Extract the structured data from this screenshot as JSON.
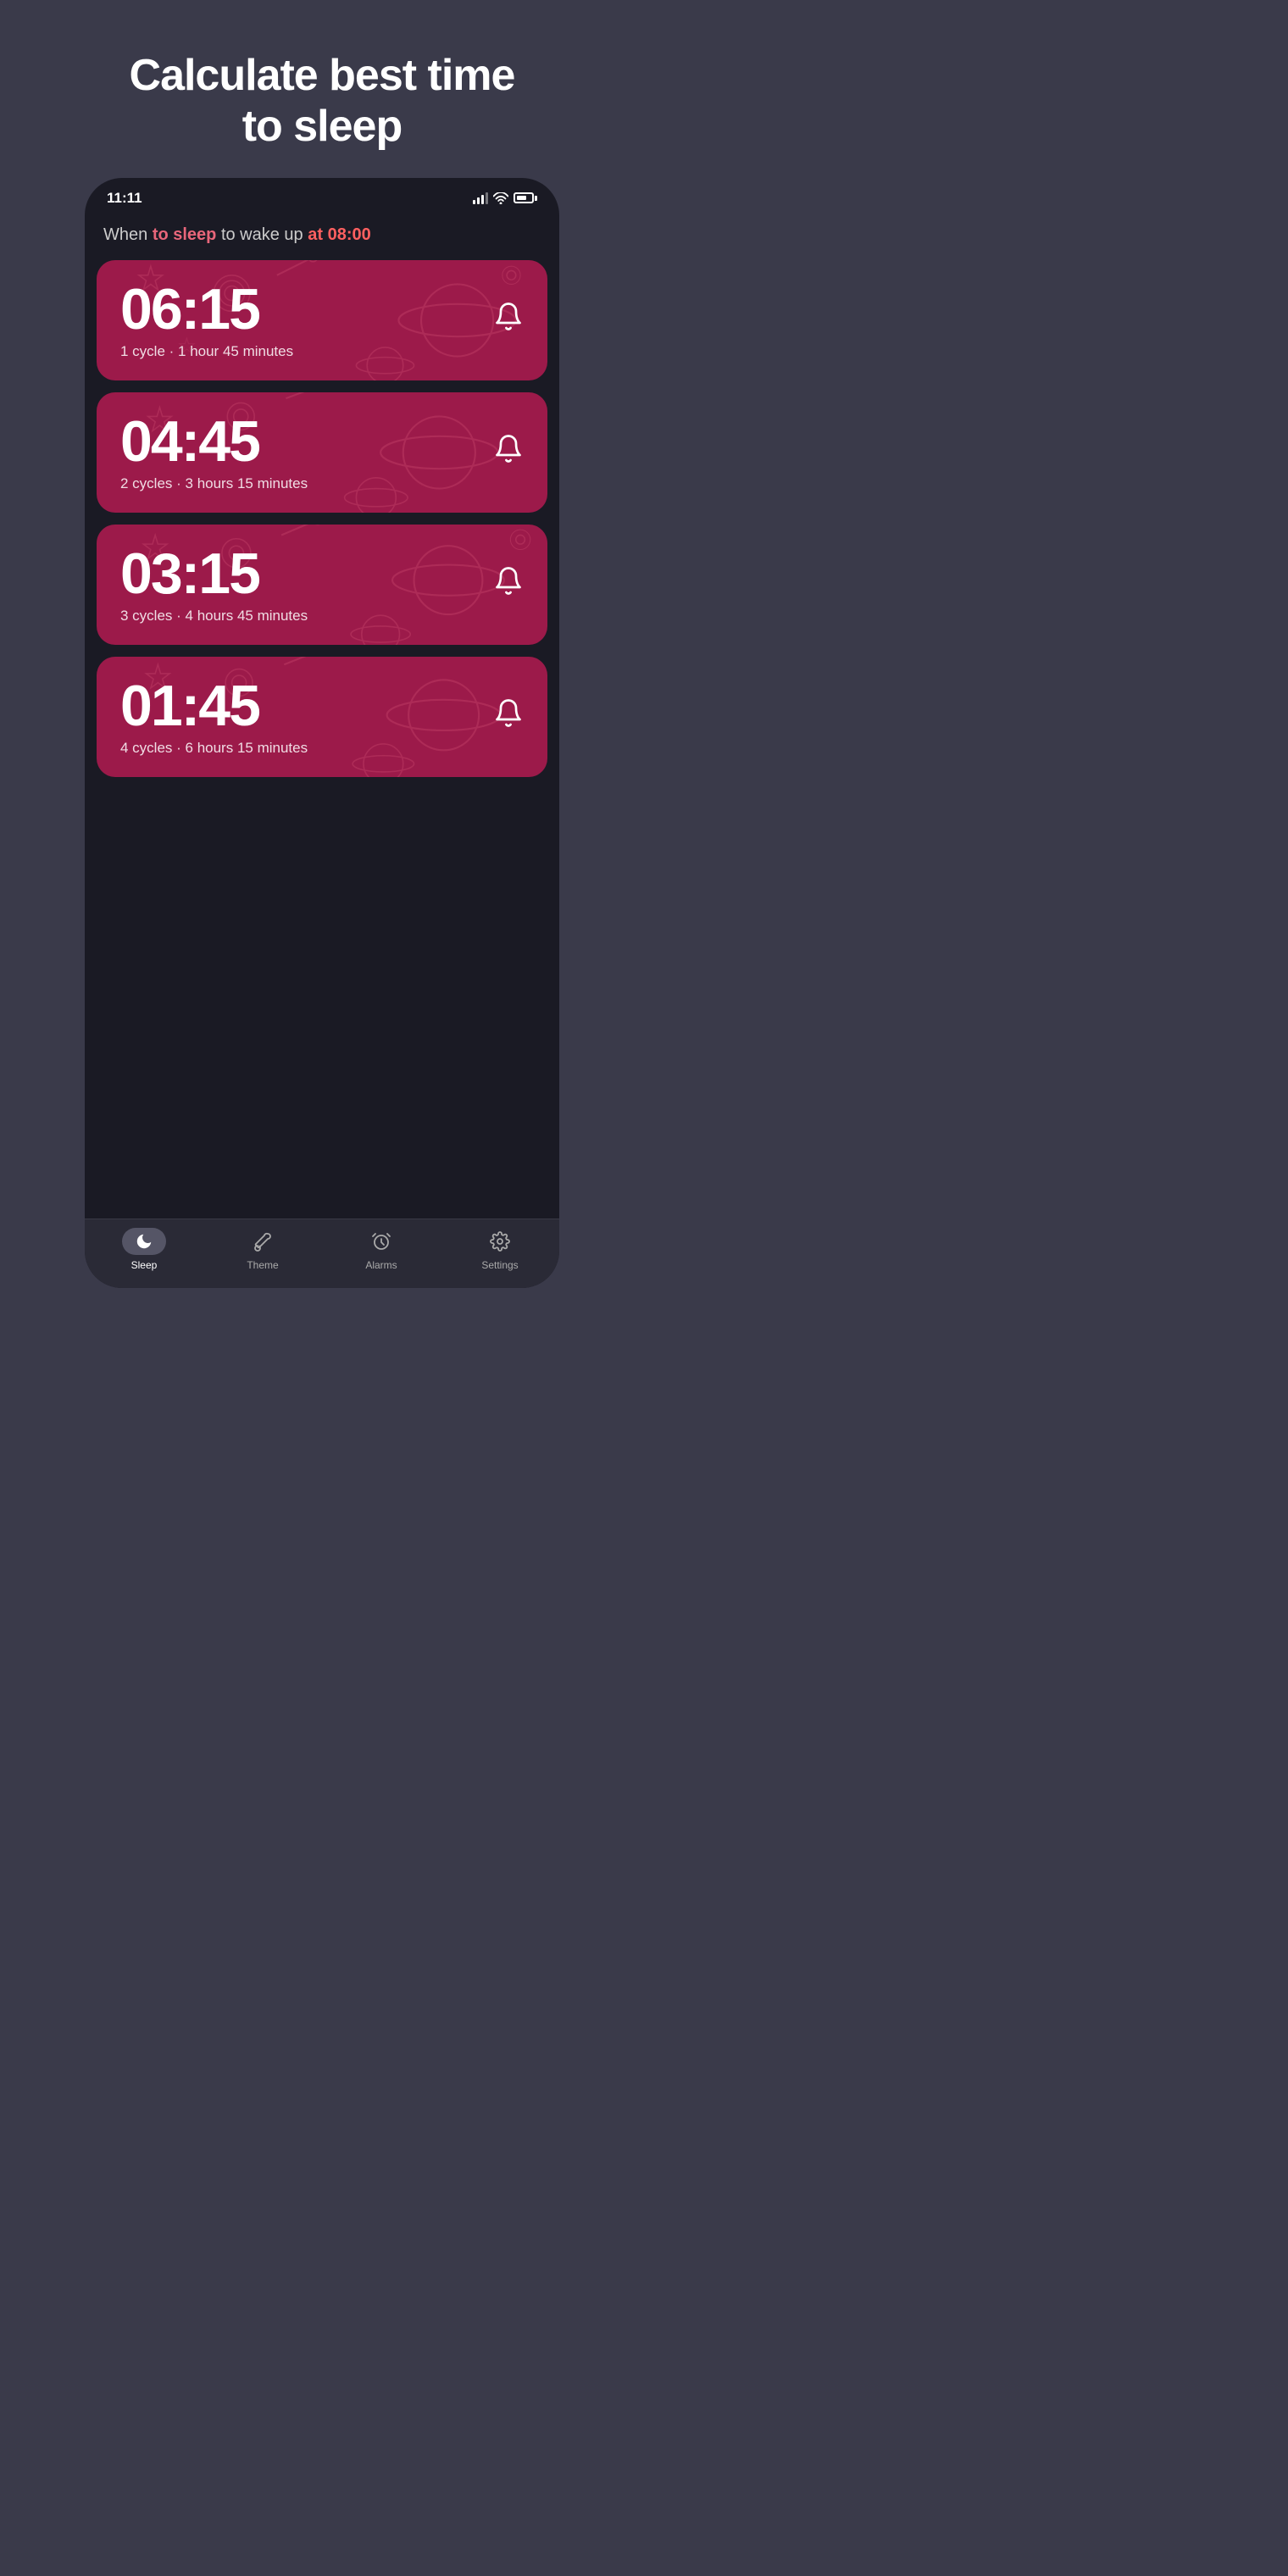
{
  "page": {
    "title": "Calculate best time\nto sleep",
    "background_color": "#3a3a4a"
  },
  "phone": {
    "status_bar": {
      "time": "11:11"
    },
    "subtitle": {
      "text_before": "When ",
      "highlight1": "to sleep",
      "text_middle": " to wake up ",
      "highlight2": "at 08:00"
    },
    "cards": [
      {
        "time": "06:15",
        "description": "1 cycle · 1 hour 45 minutes"
      },
      {
        "time": "04:45",
        "description": "2 cycles · 3 hours 15 minutes"
      },
      {
        "time": "03:15",
        "description": "3 cycles · 4 hours 45 minutes"
      },
      {
        "time": "01:45",
        "description": "4 cycles · 6 hours 15 minutes"
      }
    ],
    "nav": {
      "items": [
        {
          "id": "sleep",
          "label": "Sleep",
          "active": true,
          "icon": "moon"
        },
        {
          "id": "theme",
          "label": "Theme",
          "active": false,
          "icon": "paintbrush"
        },
        {
          "id": "alarms",
          "label": "Alarms",
          "active": false,
          "icon": "alarm"
        },
        {
          "id": "settings",
          "label": "Settings",
          "active": false,
          "icon": "gear"
        }
      ]
    }
  }
}
